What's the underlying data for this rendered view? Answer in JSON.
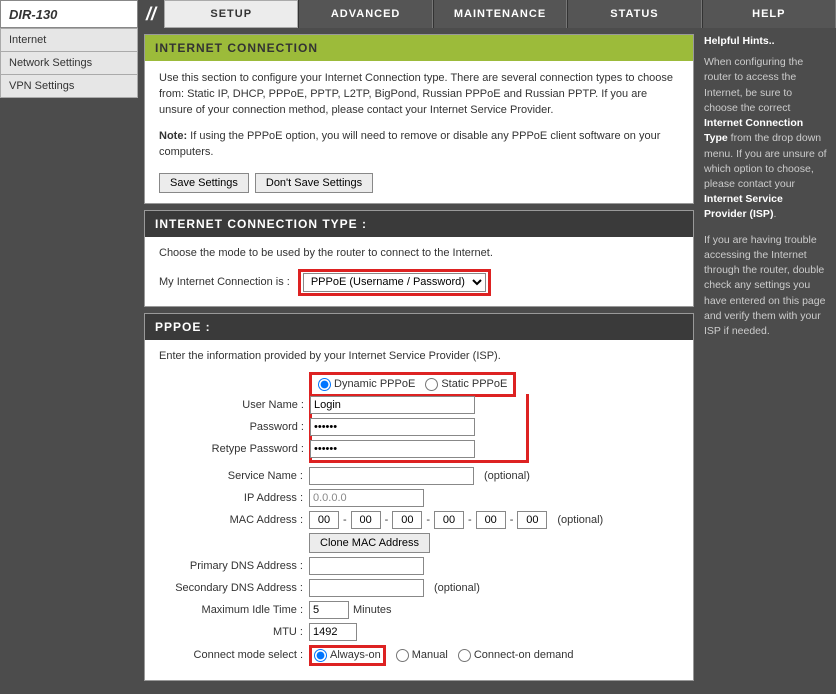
{
  "model": "DIR-130",
  "tabs": {
    "setup": "SETUP",
    "advanced": "ADVANCED",
    "maintenance": "MAINTENANCE",
    "status": "STATUS",
    "help": "HELP"
  },
  "leftnav": {
    "internet": "Internet",
    "network": "Network Settings",
    "vpn": "VPN Settings"
  },
  "intro": {
    "title": "INTERNET CONNECTION",
    "text": "Use this section to configure your Internet Connection type. There are several connection types to choose from: Static IP, DHCP, PPPoE, PPTP, L2TP, BigPond, Russian PPPoE and Russian PPTP. If you are unsure of your connection method, please contact your Internet Service Provider.",
    "note_label": "Note:",
    "note_text": " If using the PPPoE option, you will need to remove or disable any PPPoE client software on your computers.",
    "save": "Save Settings",
    "dont_save": "Don't Save Settings"
  },
  "conntype": {
    "title": "INTERNET CONNECTION TYPE :",
    "desc": "Choose the mode to be used by the router to connect to the Internet.",
    "label": "My Internet Connection is :",
    "value": "PPPoE (Username / Password)"
  },
  "pppoe": {
    "title": "PPPOE :",
    "desc": "Enter the information provided by your Internet Service Provider (ISP).",
    "dynamic": "Dynamic PPPoE",
    "static": "Static PPPoE",
    "user_label": "User Name :",
    "user_value": "Login",
    "password_label": "Password :",
    "password_value": "••••••",
    "retype_label": "Retype Password :",
    "retype_value": "••••••",
    "service_label": "Service Name :",
    "ip_label": "IP Address :",
    "ip_value": "0.0.0.0",
    "mac_label": "MAC Address :",
    "mac": [
      "00",
      "00",
      "00",
      "00",
      "00",
      "00"
    ],
    "clone": "Clone MAC Address",
    "dns1_label": "Primary DNS Address :",
    "dns2_label": "Secondary DNS Address :",
    "idle_label": "Maximum Idle Time :",
    "idle_value": "5",
    "idle_unit": "Minutes",
    "mtu_label": "MTU :",
    "mtu_value": "1492",
    "connmode_label": "Connect mode select :",
    "always": "Always-on",
    "manual": "Manual",
    "ondemand": "Connect-on demand",
    "optional": "(optional)"
  },
  "help": {
    "title": "Helpful Hints..",
    "p1a": "When configuring the router to access the Internet, be sure to choose the correct ",
    "p1b": "Internet Connection Type",
    "p1c": " from the drop down menu. If you are unsure of which option to choose, please contact your ",
    "p1d": "Internet Service Provider (ISP)",
    "p1e": ".",
    "p2": "If you are having trouble accessing the Internet through the router, double check any settings you have entered on this page and verify them with your ISP if needed."
  }
}
